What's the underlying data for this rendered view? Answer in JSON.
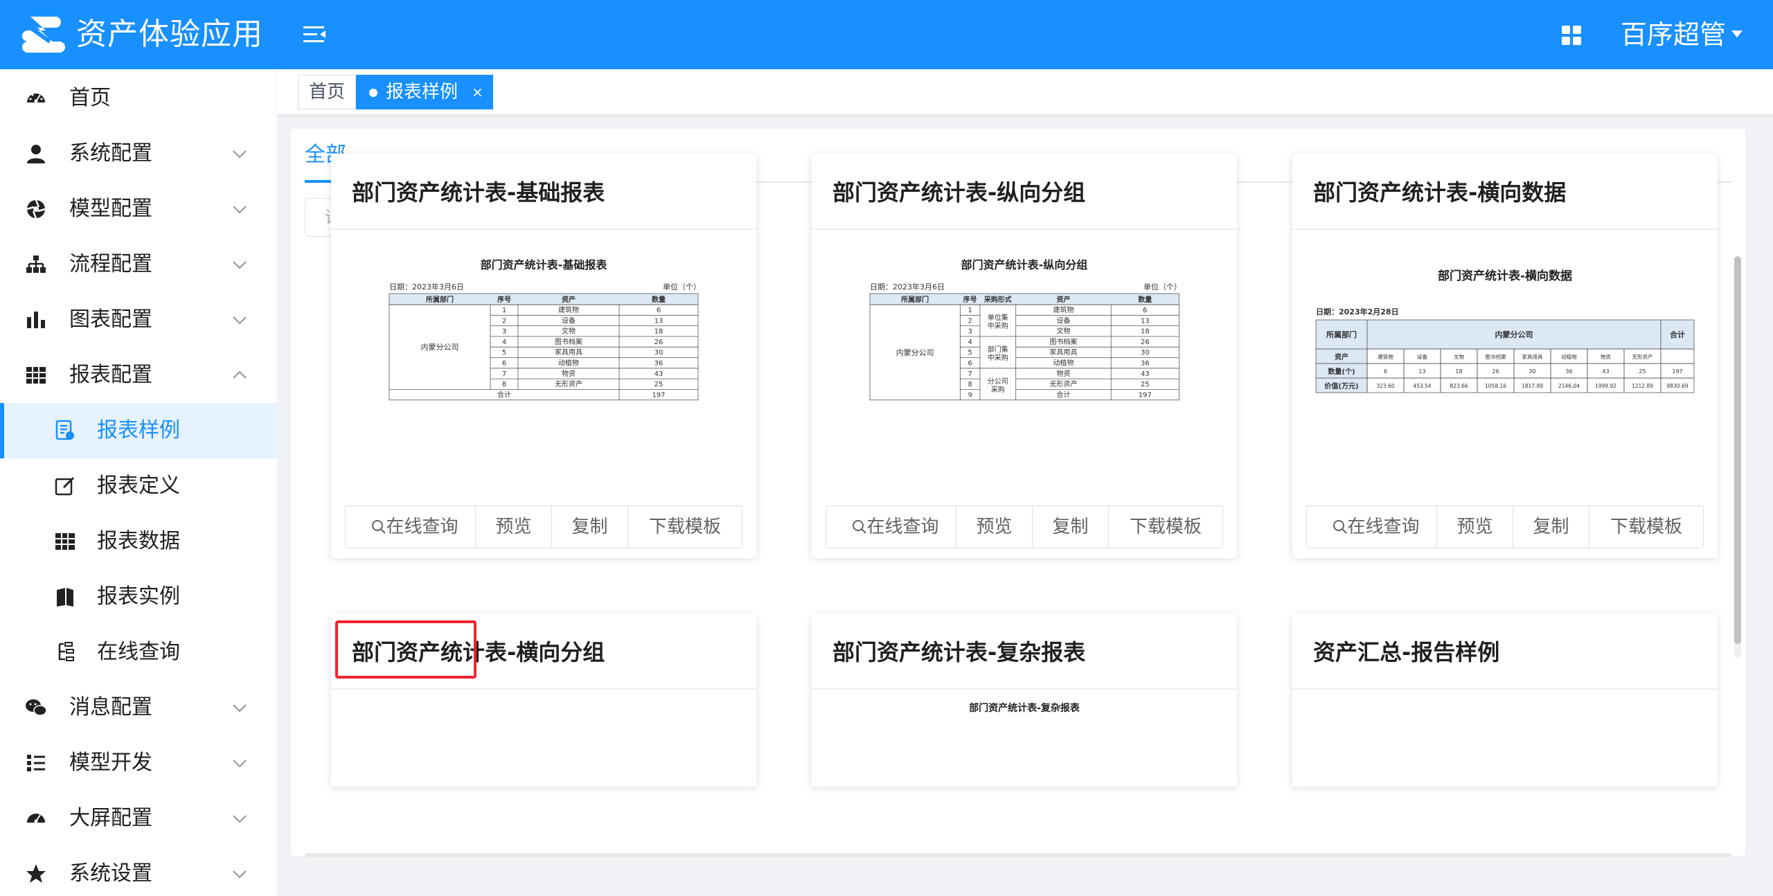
{
  "header": {
    "app_title": "资产体验应用",
    "user_name": "百序超管"
  },
  "sidebar": {
    "items": [
      {
        "label": "首页",
        "icon": "dashboard-icon",
        "expandable": false
      },
      {
        "label": "系统配置",
        "icon": "user-icon",
        "expandable": true
      },
      {
        "label": "模型配置",
        "icon": "aperture-icon",
        "expandable": true
      },
      {
        "label": "流程配置",
        "icon": "org-tree-icon",
        "expandable": true
      },
      {
        "label": "图表配置",
        "icon": "bar-chart-icon",
        "expandable": true
      },
      {
        "label": "报表配置",
        "icon": "table-icon",
        "expandable": true,
        "expanded": true
      },
      {
        "label": "报表样例",
        "icon": "report-sample-icon",
        "sub": true,
        "active": true
      },
      {
        "label": "报表定义",
        "icon": "edit-icon",
        "sub": true
      },
      {
        "label": "报表数据",
        "icon": "grid-icon",
        "sub": true
      },
      {
        "label": "报表实例",
        "icon": "book-icon",
        "sub": true
      },
      {
        "label": "在线查询",
        "icon": "tree-list-icon",
        "sub": true
      },
      {
        "label": "消息配置",
        "icon": "wechat-icon",
        "expandable": true
      },
      {
        "label": "模型开发",
        "icon": "list-icon",
        "expandable": true
      },
      {
        "label": "大屏配置",
        "icon": "gauge-icon",
        "expandable": true
      },
      {
        "label": "系统设置",
        "icon": "star-icon",
        "expandable": true
      }
    ]
  },
  "tags": {
    "home": "首页",
    "active": "报表样例",
    "close": "×"
  },
  "main": {
    "tab_all": "全部",
    "search_placeholder": "请输入查询条件",
    "buttons": {
      "query": "在线查询",
      "preview": "预览",
      "copy": "复制",
      "download": "下载模板"
    },
    "cards": [
      {
        "title": "部门资产统计表-基础报表"
      },
      {
        "title": "部门资产统计表-纵向分组"
      },
      {
        "title": "部门资产统计表-横向数据"
      },
      {
        "title": "部门资产统计表-横向分组"
      },
      {
        "title": "部门资产统计表-复杂报表"
      },
      {
        "title": "资产汇总-报告样例"
      }
    ]
  },
  "previews": {
    "basic": {
      "title": "部门资产统计表-基础报表",
      "date": "日期：2023年3月6日",
      "unit": "单位（个）",
      "headers": [
        "所属部门",
        "序号",
        "资产",
        "数量"
      ],
      "dept": "内蒙分公司",
      "rows": [
        [
          "1",
          "建筑物",
          "6"
        ],
        [
          "2",
          "设备",
          "13"
        ],
        [
          "3",
          "文物",
          "18"
        ],
        [
          "4",
          "图书档案",
          "26"
        ],
        [
          "5",
          "家具用具",
          "30"
        ],
        [
          "6",
          "动植物",
          "36"
        ],
        [
          "7",
          "物资",
          "43"
        ],
        [
          "8",
          "无形资产",
          "25"
        ]
      ],
      "total_label": "合计",
      "total": "197"
    },
    "vertical": {
      "title": "部门资产统计表-纵向分组",
      "date": "日期：2023年3月6日",
      "unit": "单位（个）",
      "headers": [
        "所属部门",
        "序号",
        "采购形式",
        "资产",
        "数量"
      ],
      "dept": "内蒙分公司",
      "groups": [
        "单位集中采购",
        "部门集中采购",
        "分公司采购"
      ],
      "rows": [
        [
          "1",
          "建筑物",
          "6"
        ],
        [
          "2",
          "设备",
          "13"
        ],
        [
          "3",
          "文物",
          "18"
        ],
        [
          "4",
          "图书档案",
          "26"
        ],
        [
          "5",
          "家具用具",
          "30"
        ],
        [
          "6",
          "动植物",
          "36"
        ],
        [
          "7",
          "物资",
          "43"
        ],
        [
          "8",
          "无形资产",
          "25"
        ],
        [
          "9",
          "合计",
          "197"
        ]
      ]
    },
    "horizontal": {
      "title": "部门资产统计表-横向数据",
      "date": "日期：2023年2月28日",
      "dept_label": "所属部门",
      "dept": "内蒙分公司",
      "total_label": "合计",
      "asset_label": "资产",
      "assets": [
        "建筑物",
        "设备",
        "文物",
        "图书档案",
        "家具用具",
        "动植物",
        "物资",
        "无形资产"
      ],
      "count_label": "数量(个)",
      "counts": [
        "6",
        "13",
        "18",
        "26",
        "30",
        "36",
        "43",
        "25",
        "197"
      ],
      "value_label": "价值(万元)",
      "values": [
        "323.60",
        "453.54",
        "823.66",
        "1058.16",
        "1817.89",
        "2146.04",
        "1999.92",
        "1212.89",
        "9830.69"
      ]
    },
    "complex": {
      "title": "部门资产统计表-复杂报表"
    }
  },
  "colors": {
    "primary": "#1890ff",
    "highlight": "#f5222d"
  }
}
